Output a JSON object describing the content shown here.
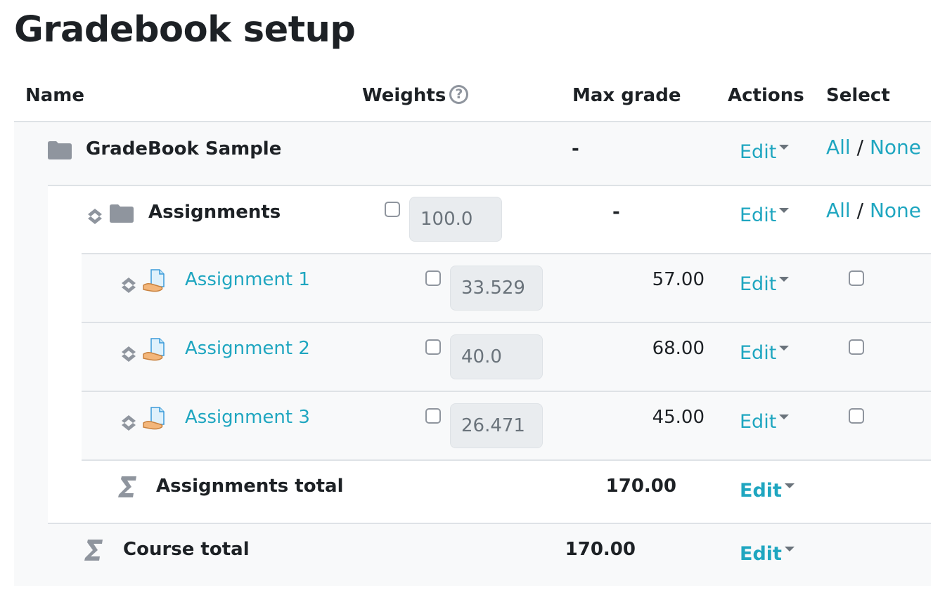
{
  "page": {
    "title": "Gradebook setup"
  },
  "columns": {
    "name": "Name",
    "weights": "Weights",
    "max_grade": "Max grade",
    "actions": "Actions",
    "select": "Select"
  },
  "category": {
    "name": "GradeBook Sample",
    "max_grade": "-",
    "edit": "Edit",
    "select_all": "All",
    "select_sep": "/",
    "select_none": "None"
  },
  "subcategory": {
    "name": "Assignments",
    "weight": "100.0",
    "max_grade": "-",
    "edit": "Edit",
    "select_all": "All",
    "select_sep": "/",
    "select_none": "None"
  },
  "items": [
    {
      "name": "Assignment 1",
      "weight": "33.529",
      "max_grade": "57.00",
      "edit": "Edit"
    },
    {
      "name": "Assignment 2",
      "weight": "40.0",
      "max_grade": "68.00",
      "edit": "Edit"
    },
    {
      "name": "Assignment 3",
      "weight": "26.471",
      "max_grade": "45.00",
      "edit": "Edit"
    }
  ],
  "subtotal": {
    "name": "Assignments total",
    "max_grade": "170.00",
    "edit": "Edit"
  },
  "course_total": {
    "name": "Course total",
    "max_grade": "170.00",
    "edit": "Edit"
  },
  "icons": {
    "help": "question-circle-icon",
    "folder": "folder-icon",
    "move": "move-arrows-icon",
    "assignment": "assignment-icon",
    "sigma": "sigma-icon"
  },
  "colors": {
    "link": "#1fa6c0",
    "text": "#1d2125",
    "muted": "#8f959e",
    "band": "#f8f9fa"
  }
}
